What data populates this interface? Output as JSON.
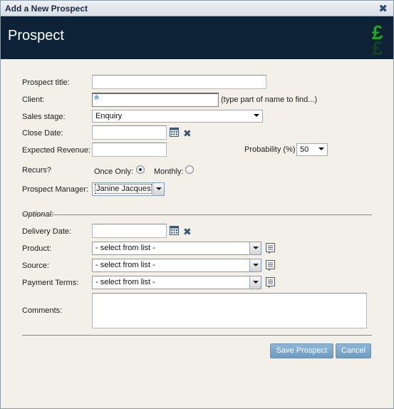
{
  "dialog": {
    "title": "Add a New Prospect",
    "heading": "Prospect"
  },
  "form": {
    "prospect_title": {
      "label": "Prospect title:",
      "value": ""
    },
    "client": {
      "label": "Client:",
      "value": "",
      "hint": "(type part of name to find...)"
    },
    "sales_stage": {
      "label": "Sales stage:",
      "value": "Enquiry"
    },
    "close_date": {
      "label": "Close Date:",
      "value": ""
    },
    "expected_revenue": {
      "label": "Expected Revenue:",
      "value": ""
    },
    "probability": {
      "label": "Probability (%)",
      "value": "50"
    },
    "recurs": {
      "label": "Recurs?",
      "once_label": "Once Only:",
      "monthly_label": "Monthly:",
      "selected": "once"
    },
    "prospect_manager": {
      "label": "Prospect Manager:",
      "value": "Janine Jacques"
    },
    "optional_label": "Optional:",
    "delivery_date": {
      "label": "Delivery Date:",
      "value": ""
    },
    "product": {
      "label": "Product:",
      "value": "- select from list -"
    },
    "source": {
      "label": "Source:",
      "value": "- select from list -"
    },
    "payment_terms": {
      "label": "Payment Terms:",
      "value": "- select from list -"
    },
    "comments": {
      "label": "Comments:",
      "value": ""
    }
  },
  "actions": {
    "save": "Save Prospect",
    "cancel": "Cancel"
  },
  "colors": {
    "banner": "#0e2237",
    "button": "#7aa6c9",
    "pound_green": "#22a822"
  },
  "icons": [
    "close-icon",
    "pound-icon",
    "calendar-icon",
    "clear-icon",
    "note-icon",
    "asterisk-icon"
  ]
}
